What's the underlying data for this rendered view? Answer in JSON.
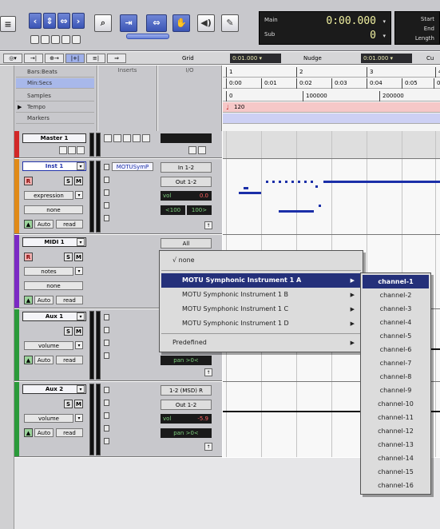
{
  "counter": {
    "main_label": "Main",
    "sub_label": "Sub",
    "main_value": "0:00.000",
    "sub_value": "0",
    "arrow": "▾"
  },
  "range": {
    "start": "Start",
    "end": "End",
    "length": "Length"
  },
  "bar2": {
    "grid_label": "Grid",
    "grid_value": "0:01.000",
    "nudge_label": "Nudge",
    "nudge_value": "0:01.000",
    "cursor_label": "Cu"
  },
  "column_headers": {
    "inserts": "Inserts",
    "io": "I/O"
  },
  "rulers": {
    "items": [
      "Bars:Beats",
      "Min:Secs",
      "Samples",
      "Tempo",
      "Markers"
    ],
    "bars_ticks": [
      "1",
      "2",
      "3",
      "4"
    ],
    "mins_ticks": [
      "0:00",
      "0:01",
      "0:02",
      "0:03",
      "0:04",
      "0:05",
      "0"
    ],
    "samples_ticks": [
      "0",
      "100000",
      "200000"
    ],
    "tempo_value": "120"
  },
  "tracks": [
    {
      "name": "Master 1",
      "color": "#d22828"
    },
    {
      "name": "Inst 1",
      "color": "#e08a18",
      "rec": "R",
      "solo": "S",
      "mute": "M",
      "param": "expression",
      "param2": "none",
      "auto_label": "Auto",
      "auto_mode": "read",
      "insert": "MOTUSymP",
      "input": "In 1-2",
      "output": "Out 1-2",
      "vol_label": "vol",
      "vol_value": "0.0",
      "pan_left": "<100",
      "pan_right": "100>"
    },
    {
      "name": "MIDI 1",
      "color": "#7b2ac4",
      "rec": "R",
      "solo": "S",
      "mute": "M",
      "param": "notes",
      "param2": "none",
      "auto_label": "Auto",
      "auto_mode": "read",
      "input": "All"
    },
    {
      "name": "Aux 1",
      "color": "#2a9a3a",
      "solo": "S",
      "mute": "M",
      "param": "volume",
      "auto_label": "Auto",
      "auto_mode": "read",
      "pan_label": "pan",
      "pan_value": ">0<"
    },
    {
      "name": "Aux 2",
      "color": "#2a9a3a",
      "solo": "S",
      "mute": "M",
      "param": "volume",
      "auto_label": "Auto",
      "auto_mode": "read",
      "input": "1-2 (MSD) R",
      "output": "Out 1-2",
      "vol_label": "vol",
      "vol_value": "-5.9",
      "pan_label": "pan",
      "pan_value": ">0<"
    }
  ],
  "menu_main": {
    "none": "√ none",
    "items": [
      "MOTU Symphonic Instrument 1 A",
      "MOTU Symphonic Instrument 1 B",
      "MOTU Symphonic Instrument 1 C",
      "MOTU Symphonic Instrument 1 D"
    ],
    "predefined": "Predefined",
    "submenu_arrow": "▶"
  },
  "menu_sub": {
    "items": [
      "channel-1",
      "channel-2",
      "channel-3",
      "channel-4",
      "channel-5",
      "channel-6",
      "channel-7",
      "channel-8",
      "channel-9",
      "channel-10",
      "channel-11",
      "channel-12",
      "channel-13",
      "channel-14",
      "channel-15",
      "channel-16"
    ]
  },
  "colors": {
    "menu_highlight": "#24307a",
    "note": "#1b2fa8"
  }
}
